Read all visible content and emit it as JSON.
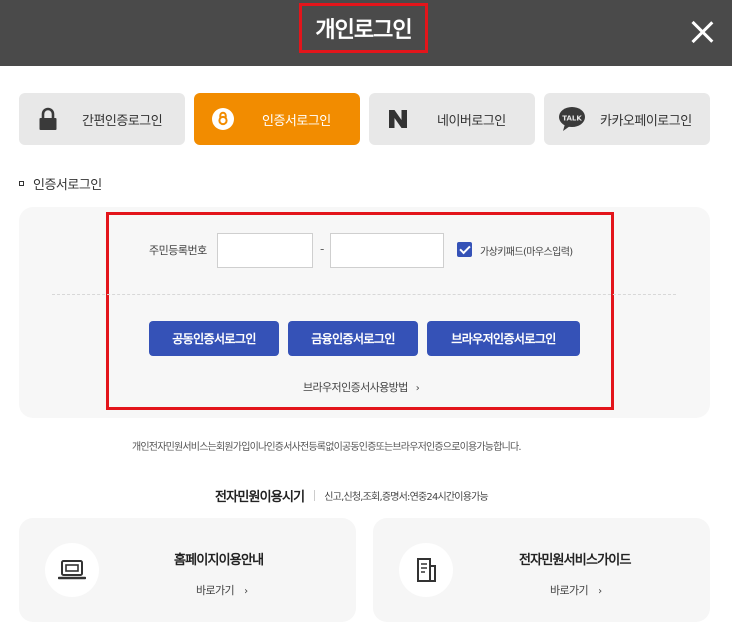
{
  "header": {
    "title": "개인로그인"
  },
  "tabs": [
    {
      "label": "간편인증로그인",
      "icon": "lock-icon",
      "active": false
    },
    {
      "label": "인증서로그인",
      "icon": "certificate-icon",
      "active": true
    },
    {
      "label": "네이버로그인",
      "icon": "naver-icon",
      "active": false
    },
    {
      "label": "카카오페이로그인",
      "icon": "kakao-talk-icon",
      "active": false
    }
  ],
  "section": {
    "title": "인증서로그인"
  },
  "login": {
    "id_label": "주민등록번호",
    "id_front": "",
    "id_back": "",
    "dash": "-",
    "virtual_keyboard_label": "가상키패드(마우스입력)",
    "virtual_keyboard_checked": true,
    "buttons": [
      "공동인증서로그인",
      "금융인증서로그인",
      "브라우저인증서로그인"
    ],
    "howto_link": "브라우저인증서사용방법",
    "arrow": "›"
  },
  "notice": "개인전자민원서비스는회원가입이나인증서사전등록없이공동인증또는브라우저인증으로이용가능합니다.",
  "eservice": {
    "title": "전자민원이용시기",
    "desc": "신고,신청,조회,증명서:연중24시간이용가능"
  },
  "cards": [
    {
      "title": "홈페이지이용안내",
      "link": "바로가기",
      "icon": "laptop-icon"
    },
    {
      "title": "전자민원서비스가이드",
      "link": "바로가기",
      "icon": "document-guide-icon"
    }
  ],
  "colors": {
    "header_bg": "#4a4a4a",
    "active_tab": "#f28c00",
    "primary_button": "#3552b7",
    "highlight": "#e3151b"
  }
}
